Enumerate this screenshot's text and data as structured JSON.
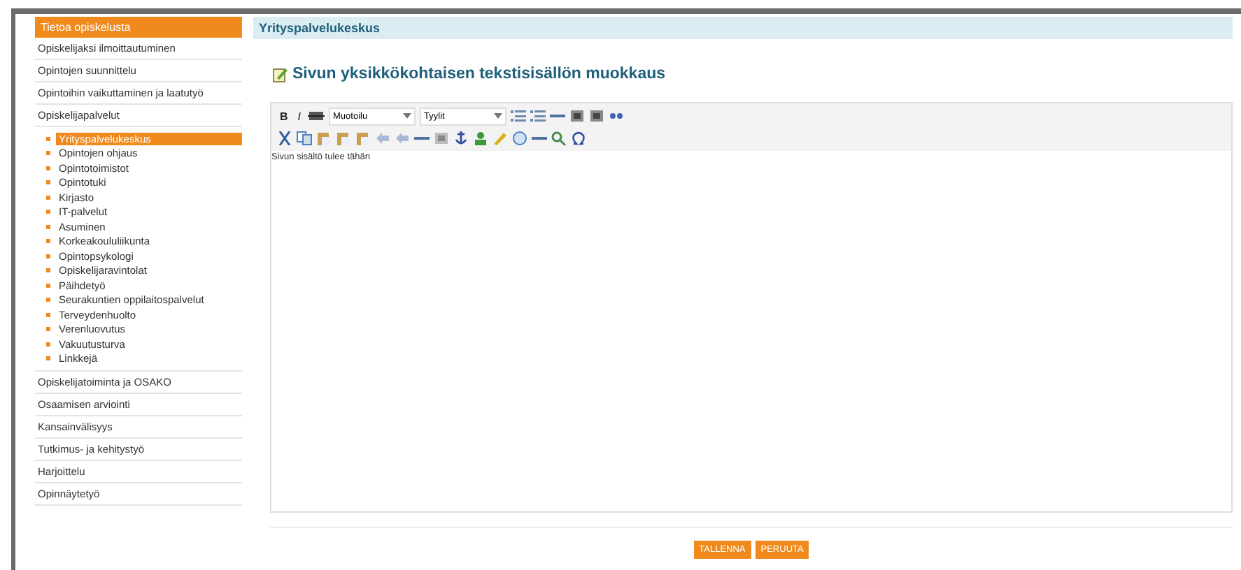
{
  "sidebar": {
    "title": "Tietoa opiskelusta",
    "items": [
      {
        "label": "Opiskelijaksi ilmoittautuminen"
      },
      {
        "label": "Opintojen suunnittelu"
      },
      {
        "label": "Opintoihin vaikuttaminen ja laatutyö"
      },
      {
        "label": "Opiskelijapalvelut",
        "children": [
          {
            "label": "Yrityspalvelukeskus",
            "selected": true
          },
          {
            "label": "Opintojen ohjaus",
            "selected": false
          },
          {
            "label": "Opintotoimistot",
            "selected": false
          },
          {
            "label": "Opintotuki",
            "selected": false
          },
          {
            "label": "Kirjasto",
            "selected": false
          },
          {
            "label": "IT-palvelut",
            "selected": false
          },
          {
            "label": "Asuminen",
            "selected": false
          },
          {
            "label": "Korkeakoululiikunta",
            "selected": false
          },
          {
            "label": "Opintopsykologi",
            "selected": false
          },
          {
            "label": "Opiskelijaravintolat",
            "selected": false
          },
          {
            "label": "Päihdetyö",
            "selected": false
          },
          {
            "label": "Seurakuntien oppilaitospalvelut",
            "selected": false
          },
          {
            "label": "Terveydenhuolto",
            "selected": false
          },
          {
            "label": "Verenluovutus",
            "selected": false
          },
          {
            "label": "Vakuutusturva",
            "selected": false
          },
          {
            "label": "Linkkejä",
            "selected": false
          }
        ]
      },
      {
        "label": "Opiskelijatoiminta ja OSAKO"
      },
      {
        "label": "Osaamisen arviointi"
      },
      {
        "label": "Kansainvälisyys"
      },
      {
        "label": "Tutkimus- ja kehitystyö"
      },
      {
        "label": "Harjoittelu"
      },
      {
        "label": "Opinnäytetyö"
      }
    ]
  },
  "content": {
    "header": "Yrityspalvelukeskus",
    "heading": "Sivun yksikkökohtaisen tekstisisällön muokkaus",
    "editor": {
      "format_buttons": [
        "B",
        "I"
      ],
      "dropdowns": [
        "Muotoilu",
        "Tyylit"
      ],
      "value": "Sivun sisältö tulee tähän"
    },
    "buttons": [
      "TALLENNA",
      "PERUUTA"
    ]
  }
}
